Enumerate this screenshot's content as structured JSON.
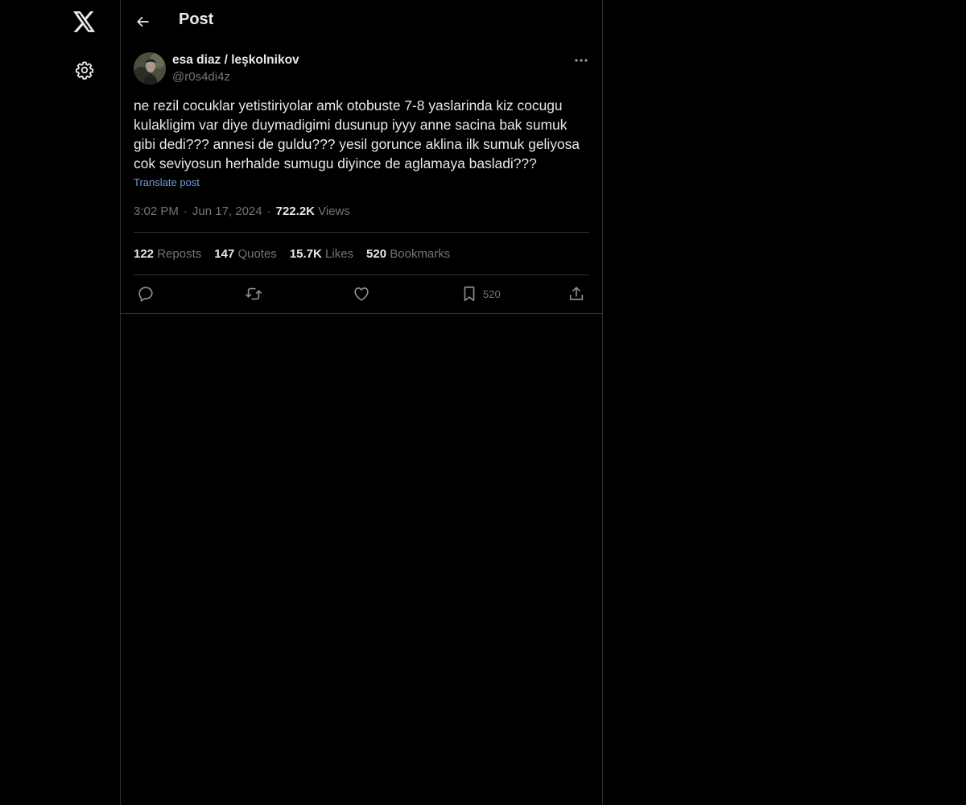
{
  "nav": {
    "logo_icon": "x-logo-icon",
    "settings_icon": "gear-icon"
  },
  "header": {
    "back_icon": "arrow-left-icon",
    "title": "Post"
  },
  "post": {
    "author": {
      "name": "esa diaz / leşkolnikov",
      "handle": "@r0s4di4z"
    },
    "text": "ne rezil cocuklar yetistiriyolar amk otobuste 7-8 yaslarinda kiz cocugu kulakligim var diye duymadigimi dusunup iyyy anne sacina bak sumuk gibi dedi??? annesi de guldu??? yesil gorunce aklina ilk sumuk geliyosa cok seviyosun herhalde sumugu diyince de aglamaya basladi???",
    "translate_label": "Translate post",
    "time": "3:02 PM",
    "date": "Jun 17, 2024",
    "separator": "·",
    "views_count": "722.2K",
    "views_label": "Views",
    "stats": [
      {
        "count": "122",
        "label": "Reposts"
      },
      {
        "count": "147",
        "label": "Quotes"
      },
      {
        "count": "15.7K",
        "label": "Likes"
      },
      {
        "count": "520",
        "label": "Bookmarks"
      }
    ],
    "actions": {
      "reply_icon": "reply-icon",
      "repost_icon": "repost-icon",
      "like_icon": "heart-icon",
      "bookmark_icon": "bookmark-icon",
      "bookmark_count": "520",
      "share_icon": "share-icon"
    }
  },
  "colors": {
    "background": "#000000",
    "text_primary": "#e7e9ea",
    "text_secondary": "#71767b",
    "link": "#6e9bd8",
    "border": "#2f3336"
  }
}
